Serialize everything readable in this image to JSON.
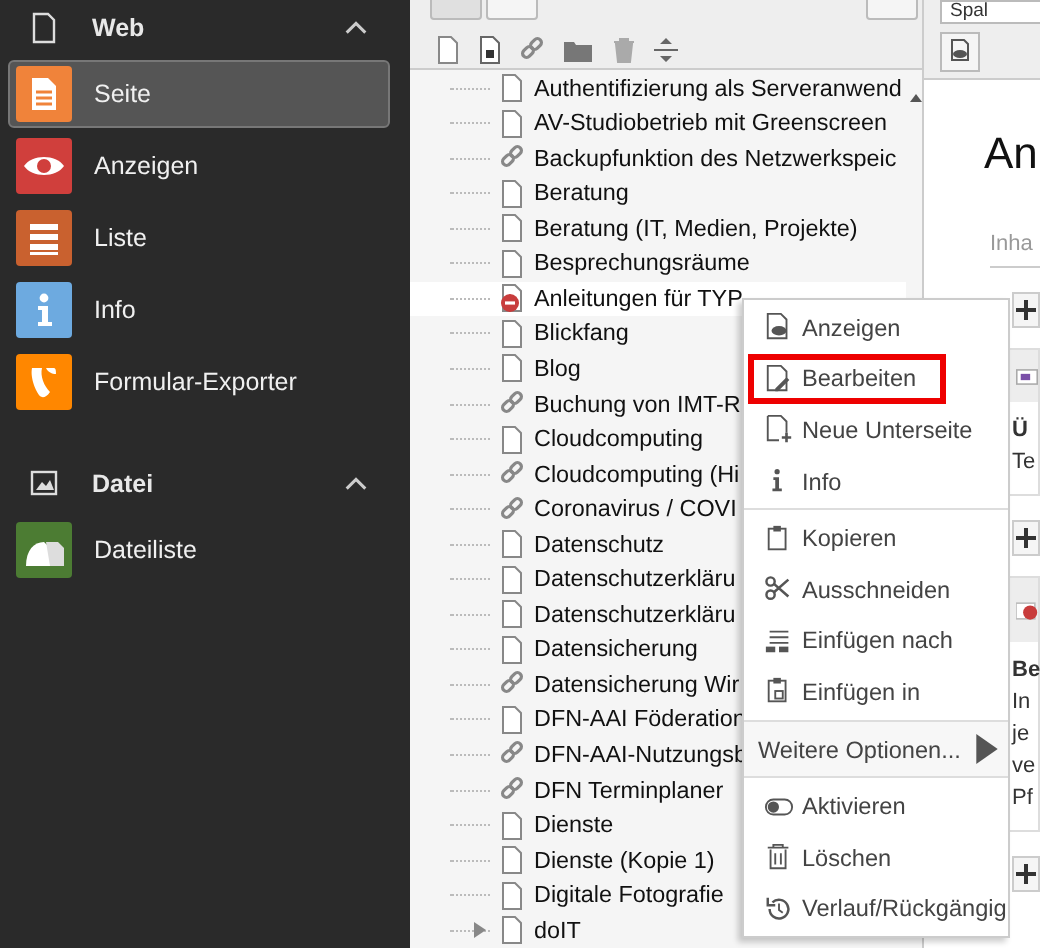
{
  "sidebar": {
    "groups": [
      {
        "title": "Web",
        "kind": "page",
        "expanded": true,
        "items": [
          {
            "label": "Seite",
            "kind": "page",
            "color": "#f0833a",
            "selected": true
          },
          {
            "label": "Anzeigen",
            "kind": "eye",
            "color": "#d03f3c",
            "selected": false
          },
          {
            "label": "Liste",
            "kind": "list",
            "color": "#c9612f",
            "selected": false
          },
          {
            "label": "Info",
            "kind": "info",
            "color": "#6daae0",
            "selected": false
          },
          {
            "label": "Formular-Exporter",
            "kind": "typo3",
            "color": "#ff8700",
            "selected": false
          }
        ]
      },
      {
        "title": "Datei",
        "kind": "image",
        "expanded": true,
        "items": [
          {
            "label": "Dateiliste",
            "kind": "files",
            "color": "#4c7c33",
            "selected": false
          }
        ]
      }
    ]
  },
  "page_tree": {
    "rows": [
      {
        "label": "Authentifizierung als Serveranwend",
        "kind": "page",
        "selected": false
      },
      {
        "label": "AV-Studiobetrieb mit Greenscreen",
        "kind": "page",
        "selected": false
      },
      {
        "label": "Backupfunktion des Netzwerkspeic",
        "kind": "link",
        "selected": false
      },
      {
        "label": "Beratung",
        "kind": "page",
        "selected": false
      },
      {
        "label": "Beratung (IT, Medien, Projekte)",
        "kind": "page",
        "selected": false
      },
      {
        "label": "Besprechungsräume",
        "kind": "page",
        "selected": false
      },
      {
        "label": "Anleitungen für TYP",
        "kind": "hidden",
        "selected": true
      },
      {
        "label": "Blickfang",
        "kind": "page",
        "selected": false
      },
      {
        "label": "Blog",
        "kind": "page",
        "selected": false
      },
      {
        "label": "Buchung von IMT-R",
        "kind": "link",
        "selected": false
      },
      {
        "label": "Cloudcomputing",
        "kind": "page",
        "selected": false
      },
      {
        "label": "Cloudcomputing (Hi",
        "kind": "link",
        "selected": false
      },
      {
        "label": "Coronavirus / COVI",
        "kind": "link",
        "selected": false
      },
      {
        "label": "Datenschutz",
        "kind": "page",
        "selected": false
      },
      {
        "label": "Datenschutzerkläru",
        "kind": "page",
        "selected": false
      },
      {
        "label": "Datenschutzerkläru",
        "kind": "page",
        "selected": false
      },
      {
        "label": "Datensicherung",
        "kind": "page",
        "selected": false
      },
      {
        "label": "Datensicherung Wir",
        "kind": "link",
        "selected": false
      },
      {
        "label": "DFN-AAI Föderation",
        "kind": "page",
        "selected": false
      },
      {
        "label": "DFN-AAI-Nutzungsb",
        "kind": "link",
        "selected": false
      },
      {
        "label": "DFN Terminplaner",
        "kind": "link",
        "selected": false
      },
      {
        "label": "Dienste",
        "kind": "page",
        "selected": false
      },
      {
        "label": "Dienste (Kopie 1)",
        "kind": "page",
        "selected": false
      },
      {
        "label": "Digitale Fotografie",
        "kind": "page",
        "selected": false
      },
      {
        "label": "doIT",
        "kind": "page",
        "selected": false,
        "expanded": false
      }
    ]
  },
  "context_menu": {
    "groups": [
      [
        {
          "label": "Anzeigen",
          "kind": "view",
          "highlighted": false
        },
        {
          "label": "Bearbeiten",
          "kind": "edit",
          "highlighted": true
        },
        {
          "label": "Neue Unterseite",
          "kind": "new",
          "highlighted": false
        },
        {
          "label": "Info",
          "kind": "info",
          "highlighted": false
        }
      ],
      [
        {
          "label": "Kopieren",
          "kind": "copy",
          "highlighted": false
        },
        {
          "label": "Ausschneiden",
          "kind": "cut",
          "highlighted": false
        },
        {
          "label": "Einfügen nach",
          "kind": "paste_after",
          "highlighted": false
        },
        {
          "label": "Einfügen in",
          "kind": "paste_into",
          "highlighted": false
        }
      ],
      [
        {
          "label": "Weitere Optionen...",
          "kind": "submenu",
          "highlighted": false
        }
      ],
      [
        {
          "label": "Aktivieren",
          "kind": "toggle",
          "highlighted": false
        },
        {
          "label": "Löschen",
          "kind": "delete",
          "highlighted": false
        },
        {
          "label": "Verlauf/Rückgängig",
          "kind": "history",
          "highlighted": false
        }
      ]
    ]
  },
  "content": {
    "column_select": "Spal",
    "page_title": "An",
    "tab": "Inha",
    "elements": [
      {
        "kind": "text",
        "heading": "Ü",
        "lines": [
          "Te"
        ]
      },
      {
        "kind": "hidden",
        "heading": "Be",
        "lines": [
          "In",
          "je",
          "ve",
          "Pf"
        ]
      }
    ]
  }
}
